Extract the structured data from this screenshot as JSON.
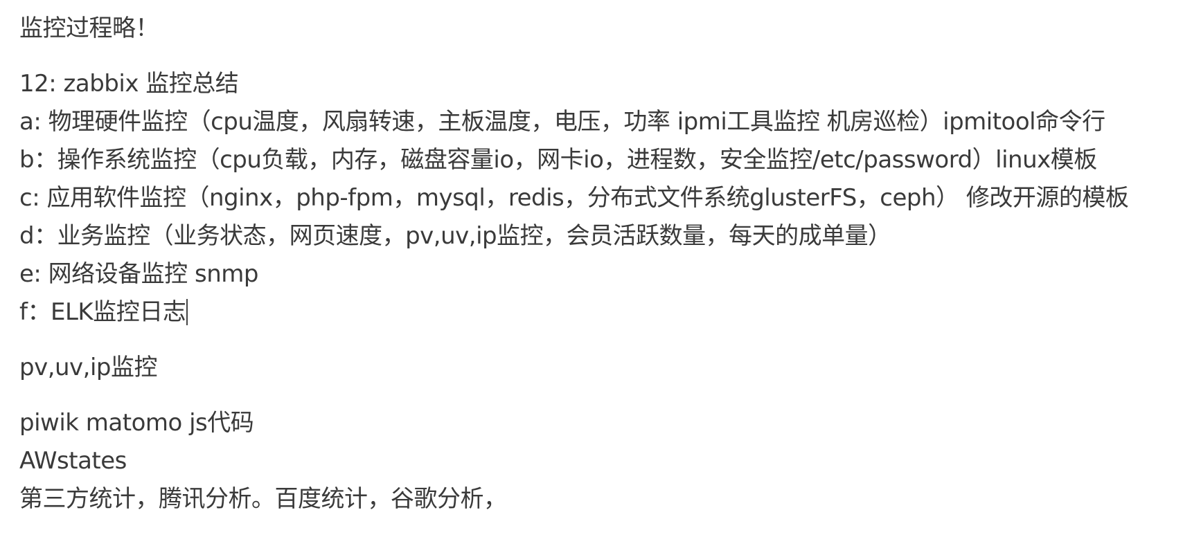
{
  "document": {
    "heading": "监控过程略！",
    "summary_title": "12: zabbix 监控总结",
    "items": [
      "a: 物理硬件监控（cpu温度，风扇转速，主板温度，电压，功率 ipmi工具监控 机房巡检）ipmitool命令行",
      "b：操作系统监控（cpu负载，内存，磁盘容量io，网卡io，进程数，安全监控/etc/password）linux模板",
      "c: 应用软件监控（nginx，php-fpm，mysql，redis，分布式文件系统glusterFS，ceph） 修改开源的模板",
      "d：业务监控（业务状态，网页速度，pv,uv,ip监控，会员活跃数量，每天的成单量）",
      "e: 网络设备监控  snmp",
      "f：ELK监控日志"
    ],
    "pv_title": "pv,uv,ip监控",
    "tools": [
      "piwik matomo  js代码",
      "AWstates",
      "第三方统计，腾讯分析。百度统计，谷歌分析，"
    ]
  }
}
